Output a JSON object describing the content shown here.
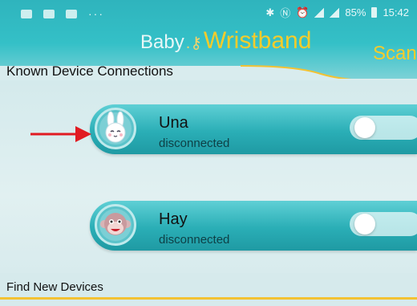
{
  "status_bar": {
    "battery": "85%",
    "time": "15:42",
    "dots": "···"
  },
  "header": {
    "logo_baby": "Baby",
    "logo_wristband": "Wristband",
    "scan_label": "Scan"
  },
  "known_section": {
    "title": "Known Device Connections"
  },
  "devices": [
    {
      "name": "Una",
      "status": "disconnected",
      "avatar_icon": "bunny-icon",
      "connected": false
    },
    {
      "name": "Hay",
      "status": "disconnected",
      "avatar_icon": "monkey-icon",
      "connected": false
    }
  ],
  "find_section": {
    "title": "Find New Devices"
  },
  "colors": {
    "accent_teal": "#2fb4bd",
    "accent_yellow": "#f7cc2a",
    "arrow_red": "#e11b22"
  }
}
